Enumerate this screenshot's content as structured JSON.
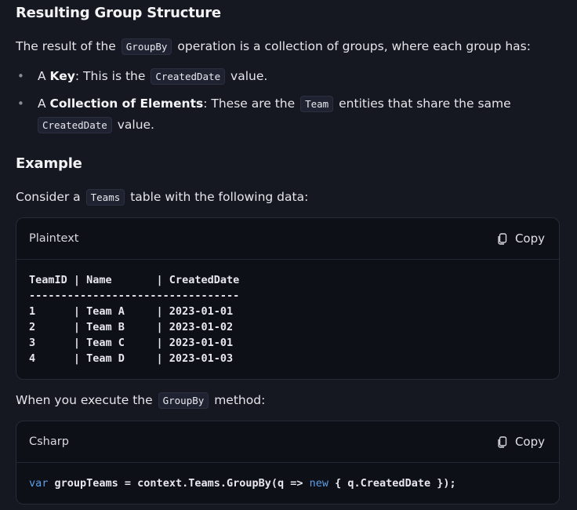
{
  "sections": {
    "structure_heading": "Resulting Group Structure",
    "example_heading": "Example"
  },
  "intro": {
    "before": "The result of the ",
    "code": "GroupBy",
    "after": " operation is a collection of groups, where each group has:"
  },
  "bullets": [
    {
      "prefix": "A ",
      "bold": "Key",
      "mid": ": This is the ",
      "code": "CreatedDate",
      "suffix": " value."
    },
    {
      "prefix": "A ",
      "bold": "Collection of Elements",
      "mid": ": These are the ",
      "code": "Team",
      "mid2": " entities that share the same",
      "code2": "CreatedDate",
      "suffix": " value."
    }
  ],
  "consider": {
    "before": "Consider a ",
    "code": "Teams",
    "after": " table with the following data:"
  },
  "table_block": {
    "language": "Plaintext",
    "copy_label": "Copy",
    "lines": [
      "TeamID | Name       | CreatedDate",
      "---------------------------------",
      "1      | Team A     | 2023-01-01",
      "2      | Team B     | 2023-01-02",
      "3      | Team C     | 2023-01-01",
      "4      | Team D     | 2023-01-03"
    ]
  },
  "execute": {
    "before": "When you execute the ",
    "code": "GroupBy",
    "after": " method:"
  },
  "csharp_block": {
    "language": "Csharp",
    "copy_label": "Copy",
    "kw1": "var",
    "part1": " groupTeams = context.Teams.GroupBy(q => ",
    "kw2": "new",
    "part2": " { q.CreatedDate });"
  },
  "icons": {
    "copy": "copy-icon",
    "bullet": "•"
  }
}
